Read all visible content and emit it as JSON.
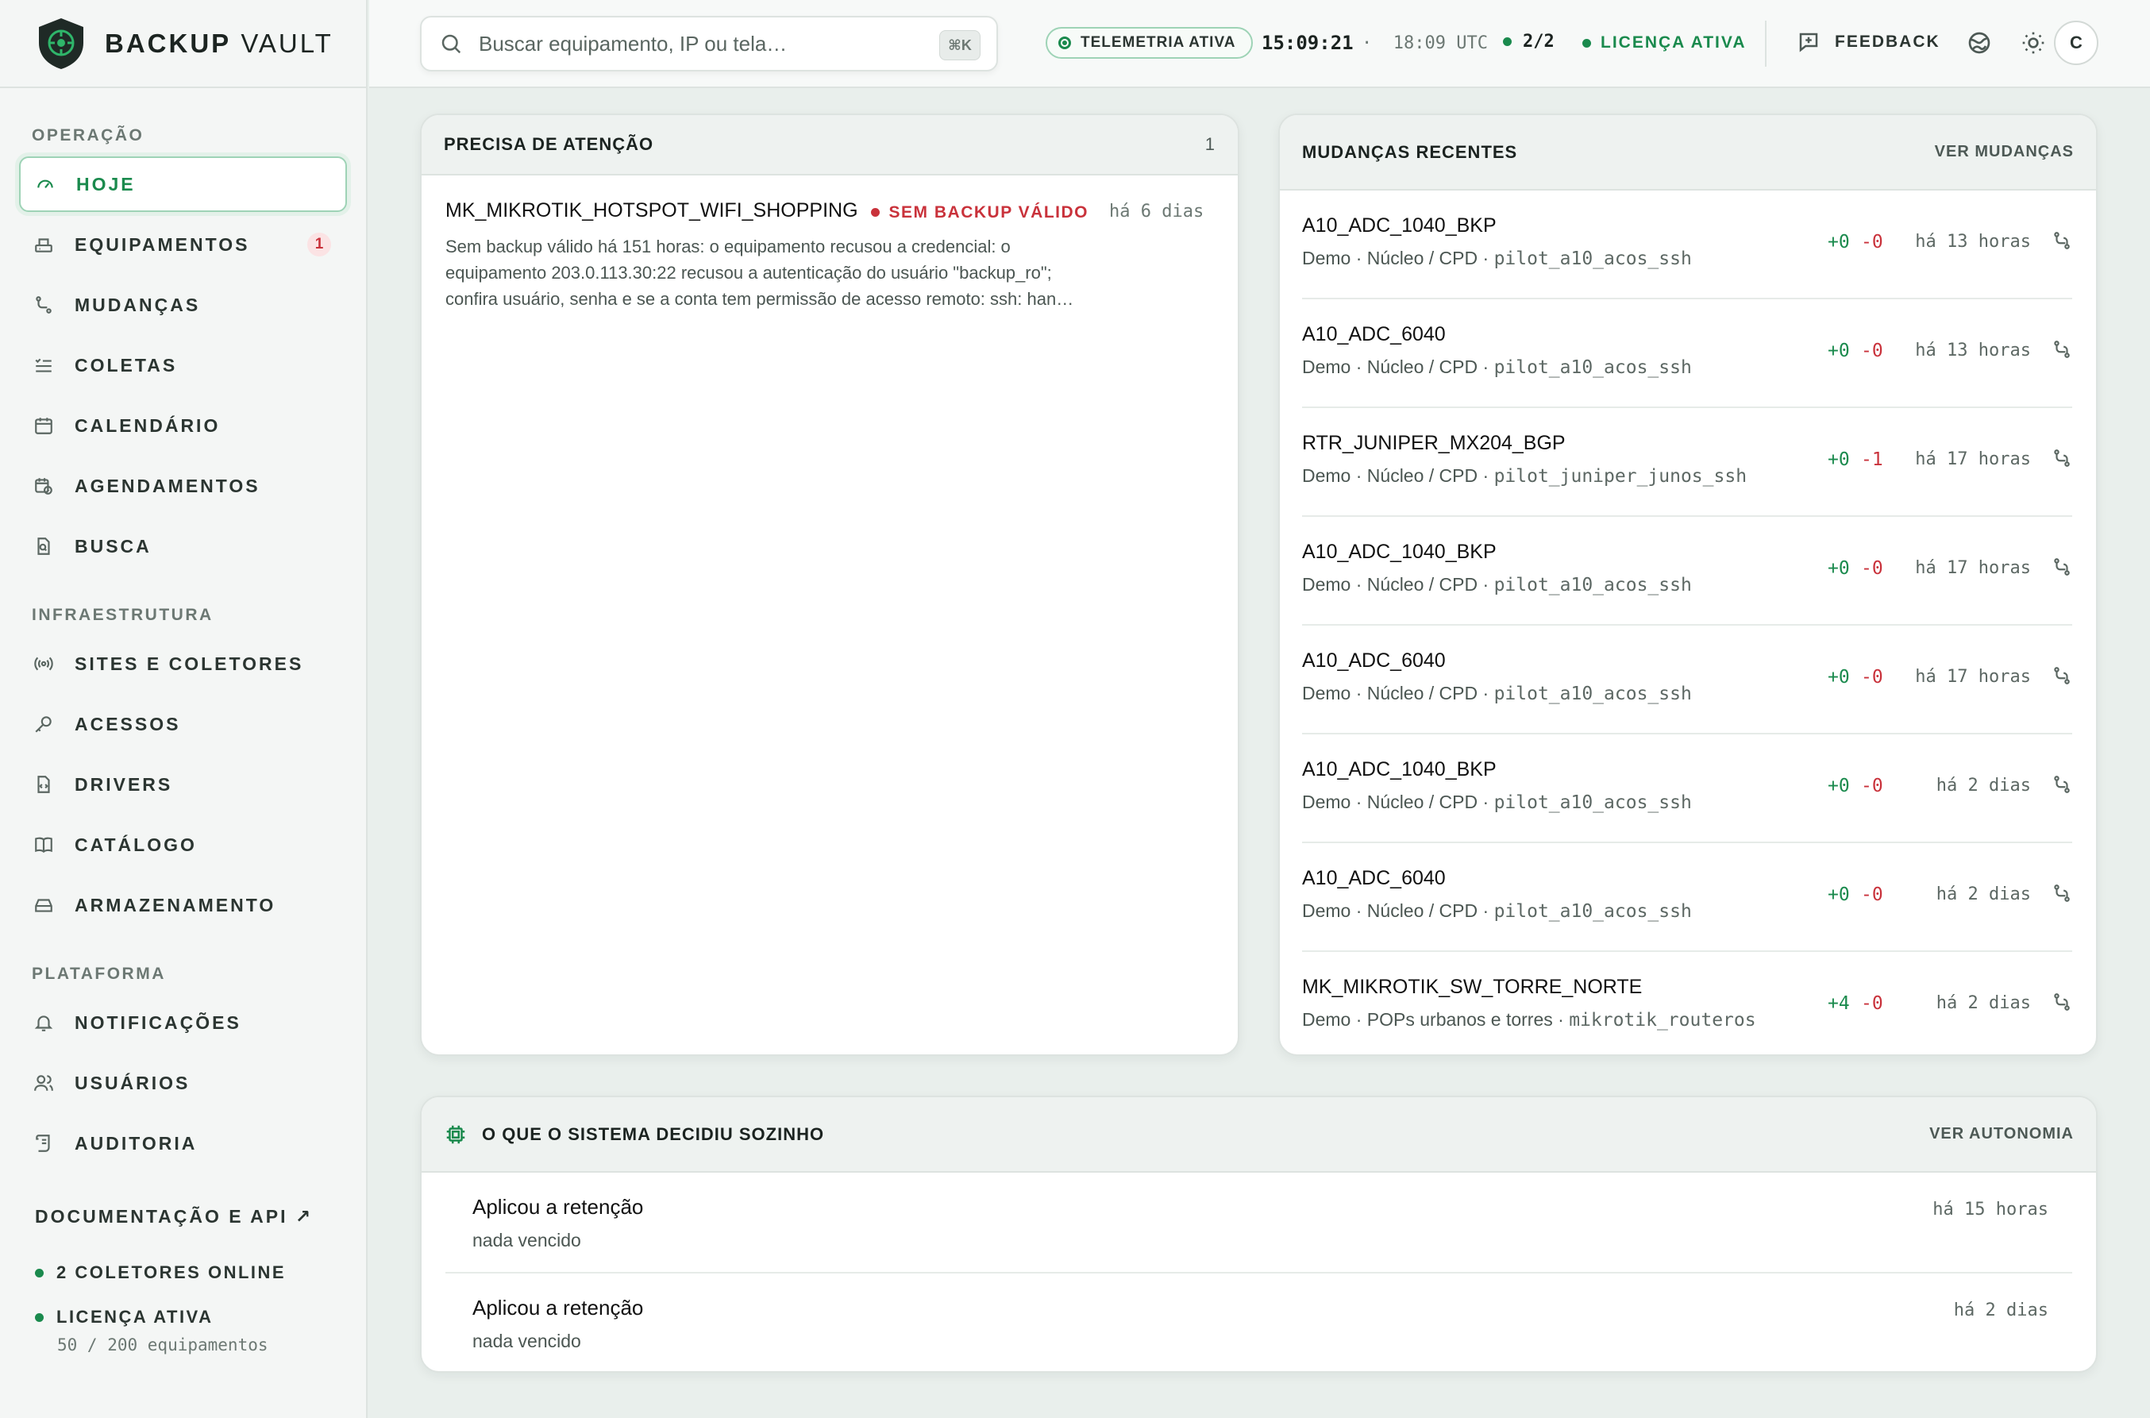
{
  "brand": {
    "bold": "BACKUP",
    "light": "VAULT"
  },
  "search": {
    "placeholder": "Buscar equipamento, IP ou tela…",
    "shortcut": "⌘K"
  },
  "topbar": {
    "telemetry": "TELEMETRIA ATIVA",
    "clock": "15:09:21",
    "separator": "·",
    "utc": "18:09 UTC",
    "collectors": "2/2",
    "license": "LICENÇA ATIVA",
    "feedback": "FEEDBACK",
    "avatar": "C",
    "icons": [
      "globe-icon",
      "sun-icon"
    ]
  },
  "sidebar": {
    "sections": [
      {
        "title": "OPERAÇÃO",
        "items": [
          {
            "label": "HOJE",
            "icon": "gauge-icon",
            "active": true
          },
          {
            "label": "EQUIPAMENTOS",
            "icon": "server-icon",
            "badge": "1"
          },
          {
            "label": "MUDANÇAS",
            "icon": "git-compare-icon"
          },
          {
            "label": "COLETAS",
            "icon": "list-check-icon"
          },
          {
            "label": "CALENDÁRIO",
            "icon": "calendar-icon"
          },
          {
            "label": "AGENDAMENTOS",
            "icon": "calendar-clock-icon"
          },
          {
            "label": "BUSCA",
            "icon": "file-search-icon"
          }
        ]
      },
      {
        "title": "INFRAESTRUTURA",
        "items": [
          {
            "label": "SITES E COLETORES",
            "icon": "radio-icon"
          },
          {
            "label": "ACESSOS",
            "icon": "key-icon"
          },
          {
            "label": "DRIVERS",
            "icon": "file-code-icon"
          },
          {
            "label": "CATÁLOGO",
            "icon": "book-icon"
          },
          {
            "label": "ARMAZENAMENTO",
            "icon": "hard-drive-icon"
          }
        ]
      },
      {
        "title": "PLATAFORMA",
        "items": [
          {
            "label": "NOTIFICAÇÕES",
            "icon": "bell-icon"
          },
          {
            "label": "USUÁRIOS",
            "icon": "users-icon"
          },
          {
            "label": "AUDITORIA",
            "icon": "scroll-icon"
          }
        ]
      }
    ],
    "docs": "DOCUMENTAÇÃO E API ↗",
    "collectors_online": "2 COLETORES ONLINE",
    "license": "LICENÇA ATIVA",
    "license_usage": "50 / 200 equipamentos"
  },
  "attention": {
    "title": "PRECISA DE ATENÇÃO",
    "count": "1",
    "items": [
      {
        "name": "MK_MIKROTIK_HOTSPOT_WIFI_SHOPPING",
        "flag": "SEM BACKUP VÁLIDO",
        "time": "há 6 dias",
        "text": "Sem backup válido há 151 horas: o equipamento recusou a credencial: o equipamento 203.0.113.30:22 recusou a autenticação do usuário \"backup_ro\"; confira usuário, senha e se a conta tem permissão de acesso remoto: ssh: han…"
      }
    ]
  },
  "changes": {
    "title": "MUDANÇAS RECENTES",
    "link": "VER MUDANÇAS",
    "rows": [
      {
        "name": "A10_ADC_1040_BKP",
        "meta": "Demo · Núcleo / CPD · ",
        "driver": "pilot_a10_acos_ssh",
        "add": "+0",
        "del": "-0",
        "time": "há 13 horas"
      },
      {
        "name": "A10_ADC_6040",
        "meta": "Demo · Núcleo / CPD · ",
        "driver": "pilot_a10_acos_ssh",
        "add": "+0",
        "del": "-0",
        "time": "há 13 horas"
      },
      {
        "name": "RTR_JUNIPER_MX204_BGP",
        "meta": "Demo · Núcleo / CPD · ",
        "driver": "pilot_juniper_junos_ssh",
        "add": "+0",
        "del": "-1",
        "time": "há 17 horas"
      },
      {
        "name": "A10_ADC_1040_BKP",
        "meta": "Demo · Núcleo / CPD · ",
        "driver": "pilot_a10_acos_ssh",
        "add": "+0",
        "del": "-0",
        "time": "há 17 horas"
      },
      {
        "name": "A10_ADC_6040",
        "meta": "Demo · Núcleo / CPD · ",
        "driver": "pilot_a10_acos_ssh",
        "add": "+0",
        "del": "-0",
        "time": "há 17 horas"
      },
      {
        "name": "A10_ADC_1040_BKP",
        "meta": "Demo · Núcleo / CPD · ",
        "driver": "pilot_a10_acos_ssh",
        "add": "+0",
        "del": "-0",
        "time": "há 2 dias"
      },
      {
        "name": "A10_ADC_6040",
        "meta": "Demo · Núcleo / CPD · ",
        "driver": "pilot_a10_acos_ssh",
        "add": "+0",
        "del": "-0",
        "time": "há 2 dias"
      },
      {
        "name": "MK_MIKROTIK_SW_TORRE_NORTE",
        "meta": "Demo · POPs urbanos e torres · ",
        "driver": "mikrotik_routeros",
        "add": "+4",
        "del": "-0",
        "time": "há 2 dias"
      }
    ]
  },
  "autonomy": {
    "title": "O QUE O SISTEMA DECIDIU SOZINHO",
    "link": "VER AUTONOMIA",
    "rows": [
      {
        "title": "Aplicou a retenção",
        "sub": "nada vencido",
        "time": "há 15 horas"
      },
      {
        "title": "Aplicou a retenção",
        "sub": "nada vencido",
        "time": "há 2 dias"
      }
    ]
  },
  "colors": {
    "accent": "#1a8a4d",
    "danger": "#c9323b",
    "background": "#e9efec"
  }
}
